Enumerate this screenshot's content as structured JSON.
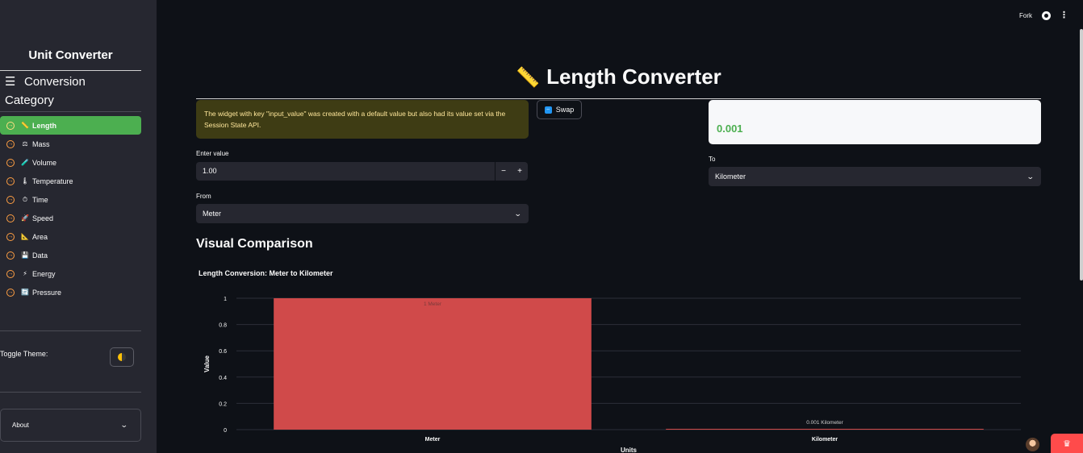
{
  "sidebar": {
    "title": "Unit Converter",
    "category_heading_line1": "Conversion",
    "category_heading_line2": "Category",
    "items": [
      {
        "label": "Length",
        "icon": "📏",
        "active": true
      },
      {
        "label": "Mass",
        "icon": "⚖",
        "active": false
      },
      {
        "label": "Volume",
        "icon": "🧪",
        "active": false
      },
      {
        "label": "Temperature",
        "icon": "🌡",
        "active": false
      },
      {
        "label": "Time",
        "icon": "⏱",
        "active": false
      },
      {
        "label": "Speed",
        "icon": "🚀",
        "active": false
      },
      {
        "label": "Area",
        "icon": "📐",
        "active": false
      },
      {
        "label": "Data",
        "icon": "💾",
        "active": false
      },
      {
        "label": "Energy",
        "icon": "⚡",
        "active": false
      },
      {
        "label": "Pressure",
        "icon": "🔄",
        "active": false
      }
    ],
    "toggle_label": "Toggle Theme:",
    "about_label": "About"
  },
  "topbar": {
    "fork_label": "Fork"
  },
  "main": {
    "title": "Length Converter",
    "title_icon": "📏",
    "warning": "The widget with key \"input_value\" was created with a default value but also had its value set via the Session State API.",
    "swap_label": "Swap",
    "result_value": "0.001",
    "enter_value_label": "Enter value",
    "input_value": "1.00",
    "stepper_minus": "−",
    "stepper_plus": "+",
    "from_label": "From",
    "from_value": "Meter",
    "to_label": "To",
    "to_value": "Kilometer",
    "section_title": "Visual Comparison"
  },
  "colors": {
    "accent_green": "#4caf50",
    "bar_red": "#d04a4a",
    "warning_bg": "#3e3c14",
    "warning_text": "#ffe79b"
  },
  "chart_data": {
    "type": "bar",
    "title": "Length Conversion: Meter to Kilometer",
    "xlabel": "Units",
    "ylabel": "Value",
    "categories": [
      "Meter",
      "Kilometer"
    ],
    "values": [
      1,
      0.001
    ],
    "data_labels": [
      "1 Meter",
      "0.001 Kilometer"
    ],
    "ylim": [
      0,
      1
    ],
    "yticks": [
      0,
      0.2,
      0.4,
      0.6,
      0.8,
      1
    ],
    "ytick_labels": [
      "0",
      "0.2",
      "0.4",
      "0.6",
      "0.8",
      "1"
    ],
    "grid": true
  }
}
